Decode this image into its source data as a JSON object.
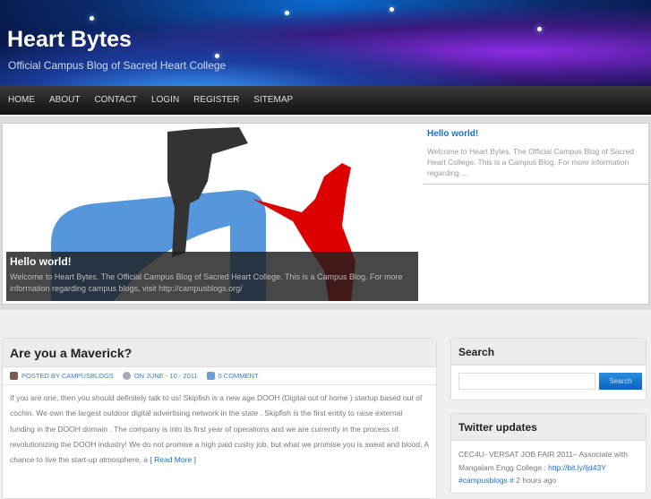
{
  "site": {
    "title": "Heart Bytes",
    "tagline": "Official Campus Blog of Sacred Heart College"
  },
  "nav": [
    "HOME",
    "ABOUT",
    "CONTACT",
    "LOGIN",
    "REGISTER",
    "SITEMAP"
  ],
  "featured": {
    "caption_title": "Hello world!",
    "caption_text": "Welcome to Heart Bytes. The Official Campus Blog of Sacred Heart College. This is a Campus Blog. For more information regarding campus blogs, visit http://campusblogs.org/",
    "side_title": "Hello world!",
    "side_text": "Welcome to Heart Bytes. The Official Campus Blog of Sacred Heart College. This is a Campus Blog. For more information regarding ..."
  },
  "post": {
    "title": "Are you a Maverick?",
    "author": "POSTED BY CAMPUSBLOGS",
    "date": "ON JUNE - 10 - 2011",
    "comments": "0 COMMENT",
    "body": "If you are one, then you should definitely talk to us! Skipfish is a new age  DOOH (Digital out of home ) startup based out of cochin. We own the largest outdoor digital advertising network in the state .  Skipfish is the first entity to raise external funding in the DOOH domain . The company is  into its  first year of operations and  we are  currently in the process of revolutionizing the DOOH industry! We do not promise a high paid  cushy job, but  what we promise you is sweat and blood, A chance to live the start-up  atmosphere, a ",
    "read_more": "[ Read More ]"
  },
  "search": {
    "title": "Search",
    "button": "Search",
    "value": ""
  },
  "twitter": {
    "title": "Twitter updates",
    "text": "CEC4U- VERSAT JOB FAIR 2011– Associate with Mangalam Engg College : ",
    "link": "http://bit.ly/ljd43Y",
    "tag": "#campusblogs #",
    "time": " 2 hours ago"
  }
}
